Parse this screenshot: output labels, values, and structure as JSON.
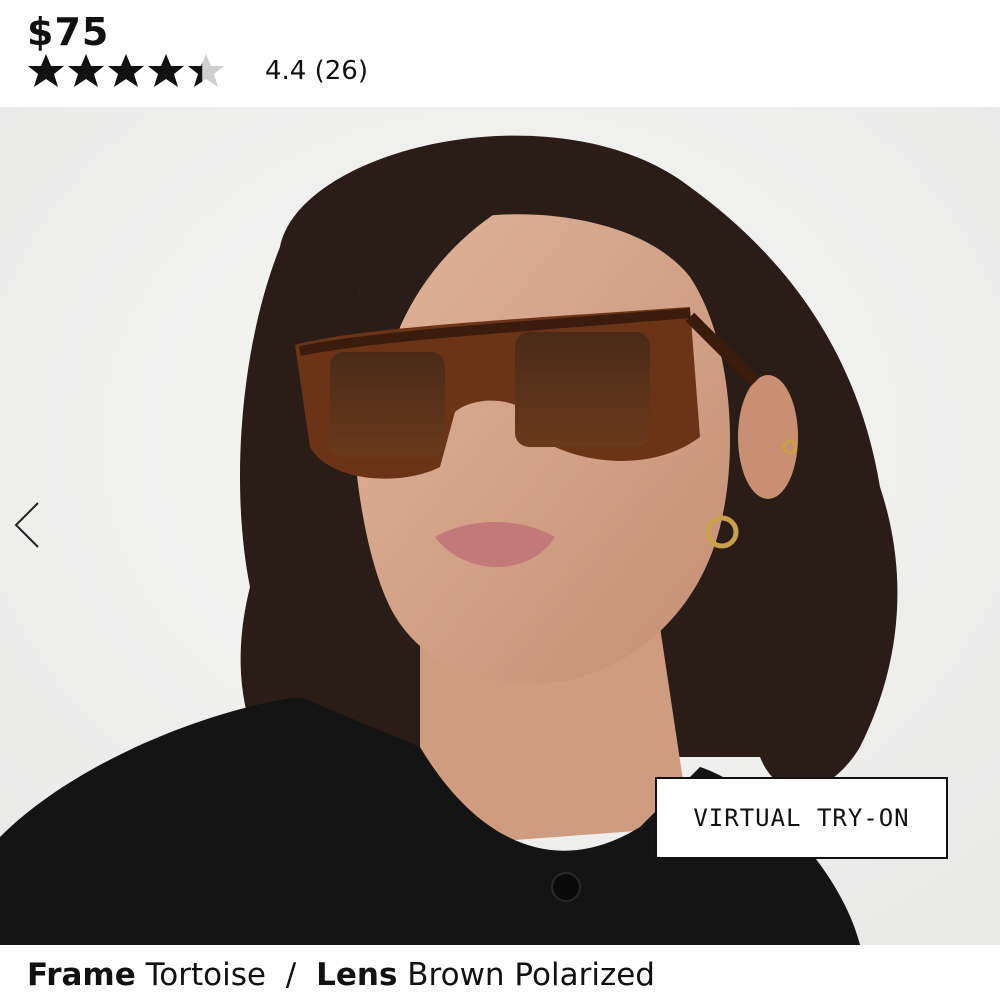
{
  "product": {
    "price": "$75",
    "rating_value": 4.4,
    "rating_max": 5,
    "rating_text": "4.4",
    "review_count": "(26)"
  },
  "gallery": {
    "prev_icon": "chevron-left-icon",
    "photo_subject": "model wearing tortoise sunglasses",
    "virtual_try_on_label": "VIRTUAL TRY-ON"
  },
  "options": {
    "frame_label": "Frame",
    "frame_value": "Tortoise",
    "separator": "/",
    "lens_label": "Lens",
    "lens_value": "Brown Polarized"
  },
  "colors": {
    "text": "#111111",
    "star_filled": "#111111",
    "star_empty": "#cfcfcf",
    "background": "#ffffff"
  }
}
